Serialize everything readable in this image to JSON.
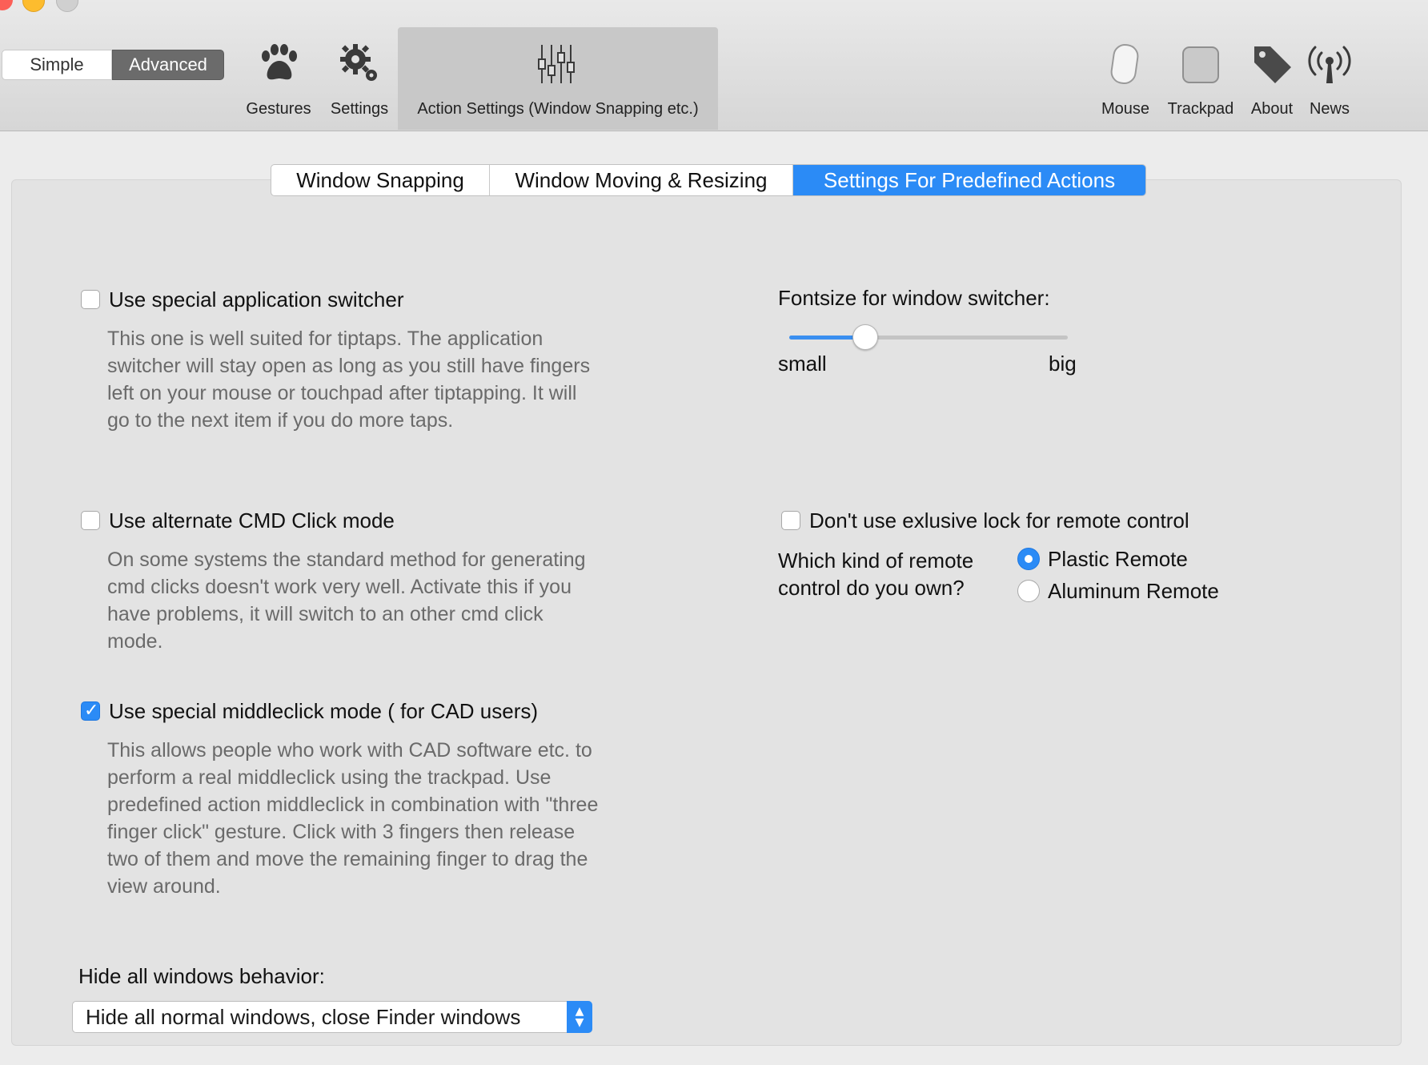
{
  "segment": {
    "simple": "Simple",
    "advanced": "Advanced"
  },
  "toolbar": {
    "gestures": "Gestures",
    "settings": "Settings",
    "action_settings": "Action Settings (Window Snapping etc.)",
    "mouse": "Mouse",
    "trackpad": "Trackpad",
    "about": "About",
    "news": "News"
  },
  "tabs": {
    "window_snapping": "Window Snapping",
    "moving_resizing": "Window Moving & Resizing",
    "predefined": "Settings For Predefined Actions"
  },
  "options": {
    "app_switcher": {
      "label": "Use special application switcher",
      "checked": false,
      "desc": "This one is well suited for tiptaps. The application switcher will stay open as long as you still have fingers left on your mouse or touchpad after tiptapping. It will go to the next item if you do more taps."
    },
    "cmd_click": {
      "label": "Use alternate CMD Click mode",
      "checked": false,
      "desc": "On some systems the standard method for generating cmd clicks doesn't work very well. Activate this if you have problems, it will switch to an other cmd click mode."
    },
    "middleclick": {
      "label": "Use special middleclick mode ( for CAD users)",
      "checked": true,
      "desc": "This allows people who work with CAD software etc. to perform a real middleclick using the trackpad. Use predefined action middleclick in combination with \"three finger click\" gesture. Click with 3 fingers then release two of them and move the remaining finger to drag the view around."
    },
    "exclusive_lock": {
      "label": "Don't use exlusive lock for remote control",
      "checked": false
    }
  },
  "fontsize": {
    "label": "Fontsize for window switcher:",
    "min_label": "small",
    "max_label": "big",
    "value": 0.27
  },
  "remote": {
    "question": "Which kind of remote control do you own?",
    "options": [
      "Plastic Remote",
      "Aluminum Remote"
    ],
    "selected": 0
  },
  "hide_windows": {
    "label": "Hide all windows behavior:",
    "selected": "Hide all normal windows, close Finder windows"
  },
  "colors": {
    "accent": "#2b8bf6"
  }
}
